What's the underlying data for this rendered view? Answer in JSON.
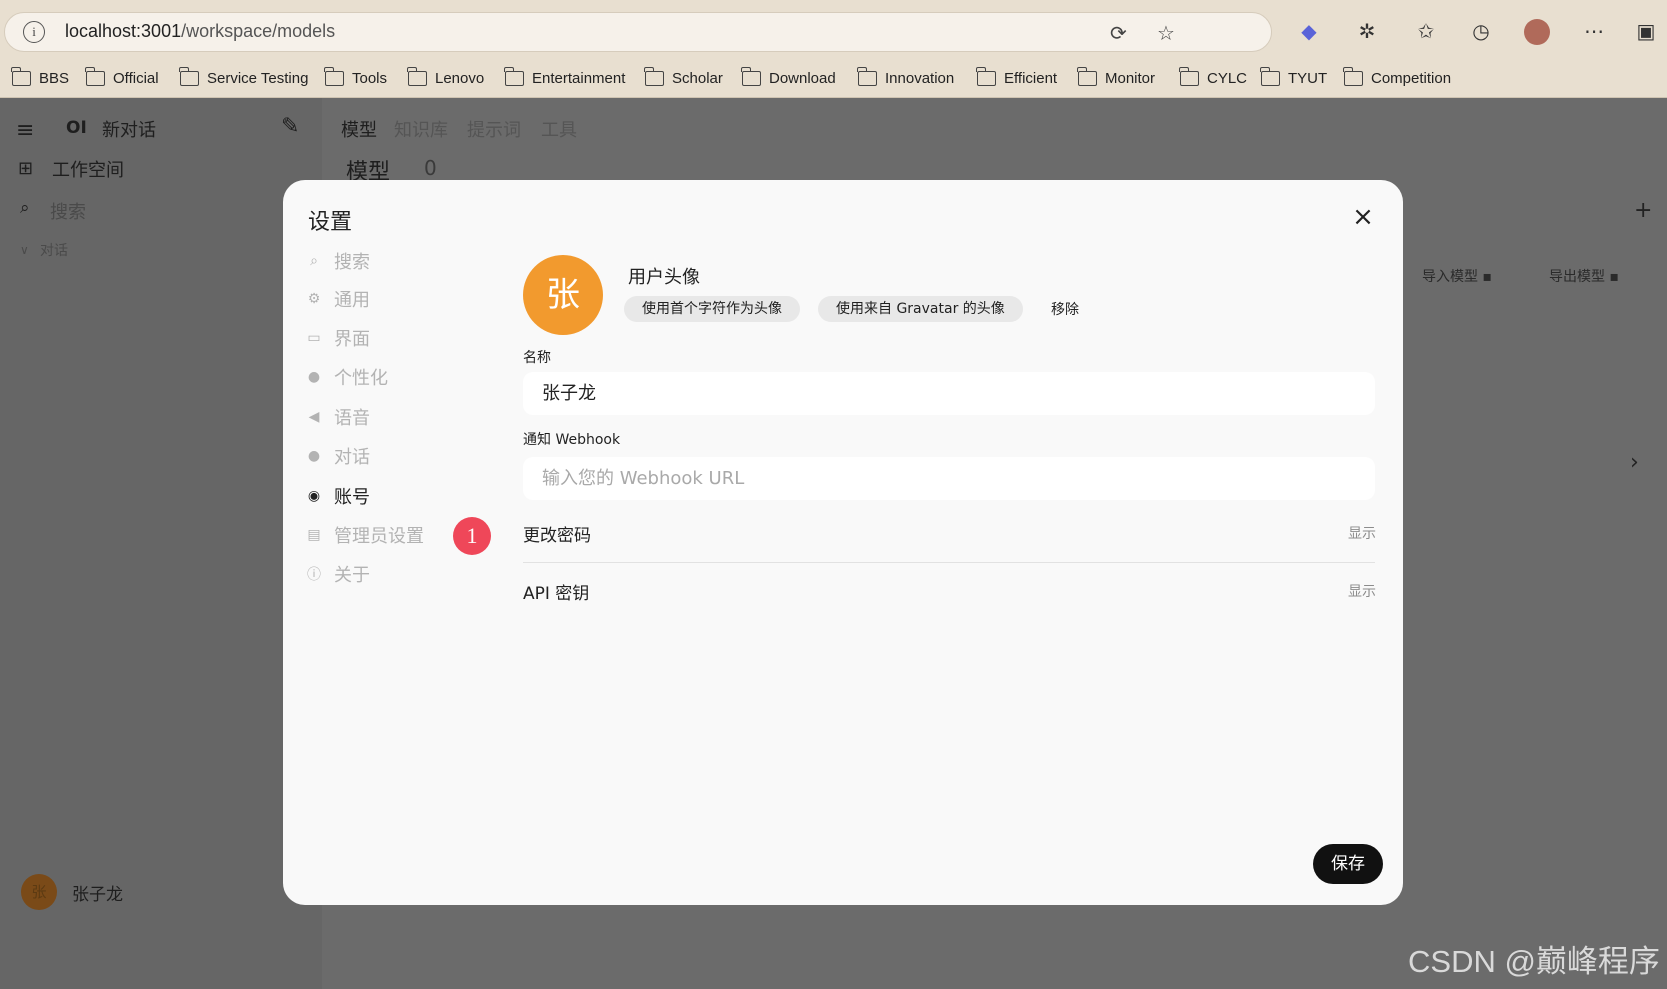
{
  "browser": {
    "url_host": "localhost:3001",
    "url_path": "/workspace/models",
    "bookmarks": [
      "BBS",
      "Official",
      "Service Testing",
      "Tools",
      "Lenovo",
      "Entertainment",
      "Scholar",
      "Download",
      "Innovation",
      "Efficient",
      "Monitor",
      "CYLC",
      "TYUT",
      "Competition"
    ]
  },
  "sidebar": {
    "logo": "OI",
    "new_chat": "新对话",
    "workspace": "工作空间",
    "search": "搜索",
    "section": "对话",
    "user_avatar": "张",
    "user_name": "张子龙"
  },
  "main": {
    "tabs": [
      "模型",
      "知识库",
      "提示词",
      "工具"
    ],
    "heading": "模型",
    "count": "0",
    "import_label": "导入模型",
    "export_label": "导出模型"
  },
  "settings": {
    "title": "设置",
    "nav": [
      {
        "label": "搜索",
        "icon": "search-icon"
      },
      {
        "label": "通用",
        "icon": "gear-icon"
      },
      {
        "label": "界面",
        "icon": "monitor-icon"
      },
      {
        "label": "个性化",
        "icon": "person-icon"
      },
      {
        "label": "语音",
        "icon": "speaker-icon"
      },
      {
        "label": "对话",
        "icon": "chat-bubble-icon"
      },
      {
        "label": "账号",
        "icon": "user-circle-icon",
        "active": true
      },
      {
        "label": "管理员设置",
        "icon": "id-card-icon"
      },
      {
        "label": "关于",
        "icon": "info-icon"
      }
    ],
    "badge": "1",
    "avatar_char": "张",
    "avatar_label": "用户头像",
    "avatar_initial_btn": "使用首个字符作为头像",
    "avatar_gravatar_btn": "使用来自 Gravatar 的头像",
    "avatar_remove": "移除",
    "name_label": "名称",
    "name_value": "张子龙",
    "webhook_label": "通知 Webhook",
    "webhook_placeholder": "输入您的 Webhook URL",
    "change_password": "更改密码",
    "change_password_action": "显示",
    "api_key": "API 密钥",
    "api_key_action": "显示",
    "save": "保存"
  },
  "watermark": "CSDN @巅峰程序"
}
